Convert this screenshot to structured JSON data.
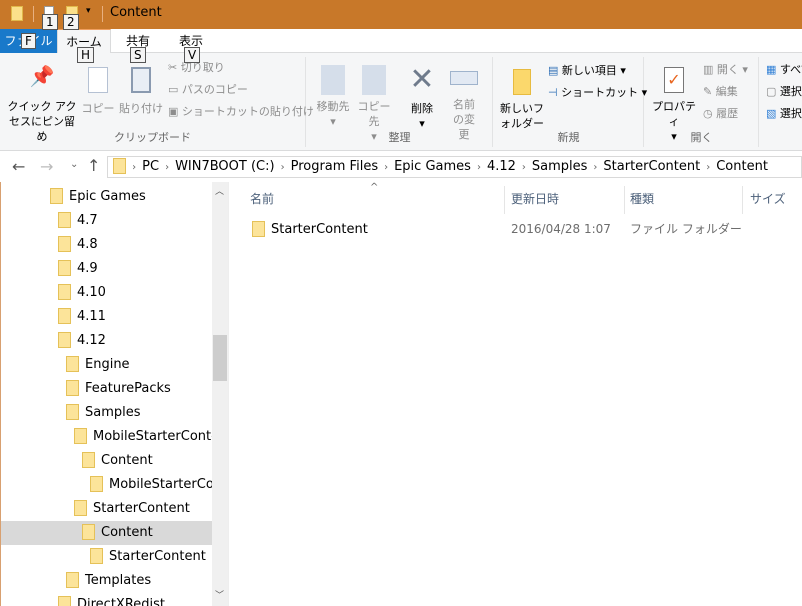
{
  "window": {
    "title": "Content",
    "accent": "#c87829"
  },
  "quick_access": {
    "keytips": [
      "1",
      "2"
    ]
  },
  "tabs": [
    {
      "label": "ファイル",
      "keytip": "F"
    },
    {
      "label": "ホーム",
      "keytip": "H"
    },
    {
      "label": "共有",
      "keytip": "S"
    },
    {
      "label": "表示",
      "keytip": "V"
    }
  ],
  "ribbon": {
    "clipboard": {
      "label": "クリップボード",
      "pin": "クイック アクセスにピン留め",
      "copy": "コピー",
      "paste": "貼り付け",
      "cut": "切り取り",
      "copy_path": "パスのコピー",
      "paste_shortcut": "ショートカットの貼り付け"
    },
    "organize": {
      "label": "整理",
      "move_to": "移動先",
      "copy_to": "コピー先",
      "delete": "削除",
      "rename": "名前の変更"
    },
    "new": {
      "label": "新規",
      "new_folder": "新しいフォルダー",
      "new_item": "新しい項目",
      "shortcut": "ショートカット"
    },
    "open": {
      "label": "開く",
      "properties": "プロパティ",
      "open": "開く",
      "edit": "編集",
      "history": "履歴"
    },
    "select": {
      "select_all": "すべて選択",
      "select_none": "選択解除",
      "invert": "選択の切り替え"
    }
  },
  "address": {
    "crumbs": [
      "PC",
      "WIN7BOOT (C:)",
      "Program Files",
      "Epic Games",
      "4.12",
      "Samples",
      "StarterContent",
      "Content"
    ]
  },
  "nav_tree": [
    {
      "label": "Epic Games",
      "level": 0
    },
    {
      "label": "4.7",
      "level": 1
    },
    {
      "label": "4.8",
      "level": 1
    },
    {
      "label": "4.9",
      "level": 1
    },
    {
      "label": "4.10",
      "level": 1
    },
    {
      "label": "4.11",
      "level": 1
    },
    {
      "label": "4.12",
      "level": 1
    },
    {
      "label": "Engine",
      "level": 2
    },
    {
      "label": "FeaturePacks",
      "level": 2
    },
    {
      "label": "Samples",
      "level": 2
    },
    {
      "label": "MobileStarterContent",
      "level": 3
    },
    {
      "label": "Content",
      "level": 4
    },
    {
      "label": "MobileStarterContent",
      "level": 5
    },
    {
      "label": "StarterContent",
      "level": 3
    },
    {
      "label": "Content",
      "level": 4,
      "selected": true
    },
    {
      "label": "StarterContent",
      "level": 5
    },
    {
      "label": "Templates",
      "level": 2
    },
    {
      "label": "DirectXRedist",
      "level": 1
    }
  ],
  "columns": [
    "名前",
    "更新日時",
    "種類",
    "サイズ"
  ],
  "files": [
    {
      "name": "StarterContent",
      "modified": "2016/04/28 1:07",
      "type": "ファイル フォルダー",
      "size": ""
    }
  ]
}
